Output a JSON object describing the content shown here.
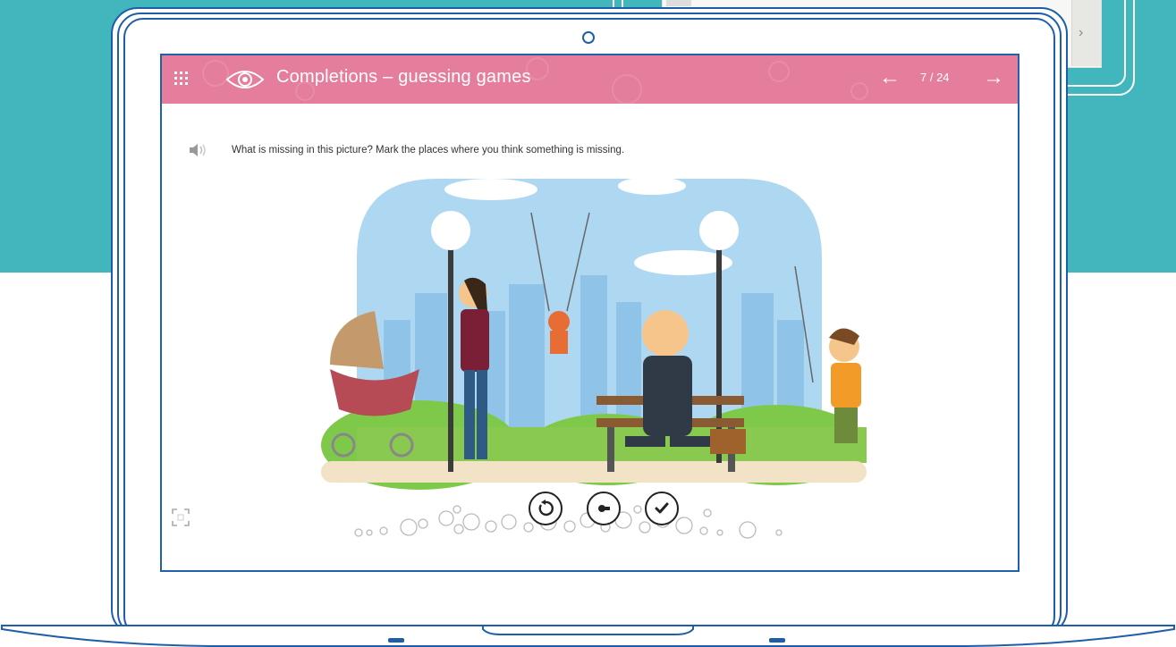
{
  "app": {
    "title": "Completions – guessing games",
    "page_counter": "7 / 24",
    "question": "What is missing in this picture? Mark the places where you think something is missing."
  },
  "icons": {
    "menu": "grid-icon",
    "brand": "eye-icon",
    "prev": "arrow-left-icon",
    "next": "arrow-right-icon",
    "audio": "speaker-icon",
    "fullscreen": "fullscreen-icon",
    "reset": "reset-icon",
    "hint": "whistle-icon",
    "check": "checkmark-icon"
  },
  "colors": {
    "header": "#e57d9c",
    "background_teal": "#41b7bd",
    "laptop_outline": "#1e5ea9"
  }
}
